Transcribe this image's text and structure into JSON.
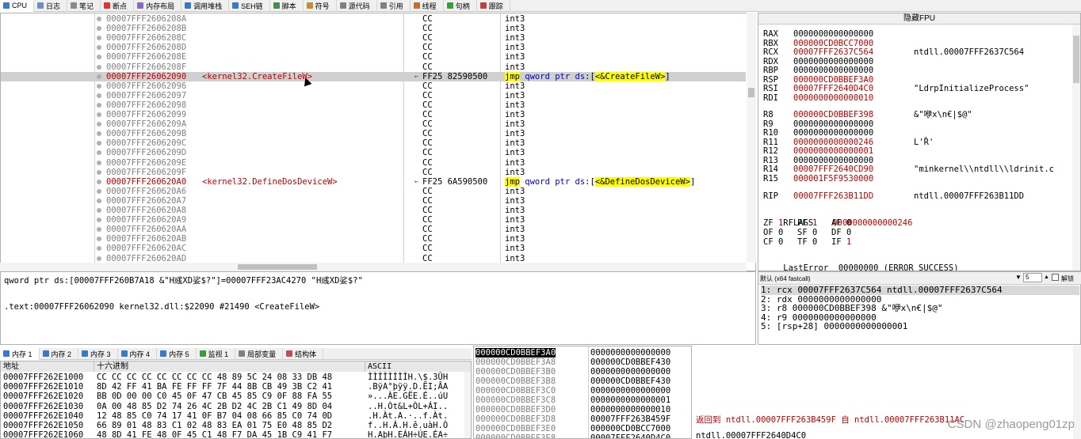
{
  "top_tabs": [
    {
      "label": "CPU",
      "color": "#3c78c8"
    },
    {
      "label": "日志",
      "color": "#6a8fc0"
    },
    {
      "label": "笔记",
      "color": "#8a8a8a"
    },
    {
      "label": "断点",
      "color": "#e03030"
    },
    {
      "label": "内存布局",
      "color": "#8a6ac0"
    },
    {
      "label": "调用堆栈",
      "color": "#3c78c8"
    },
    {
      "label": "SEH链",
      "color": "#3c78c8"
    },
    {
      "label": "脚本",
      "color": "#4a8a4a"
    },
    {
      "label": "符号",
      "color": "#c09030"
    },
    {
      "label": "源代码",
      "color": "#808080"
    },
    {
      "label": "引用",
      "color": "#808080"
    },
    {
      "label": "线程",
      "color": "#c07030"
    },
    {
      "label": "句柄",
      "color": "#3c9c3c"
    },
    {
      "label": "跟踪",
      "color": "#c04040"
    }
  ],
  "disasm_rows": [
    {
      "addr": "00007FFF2606208A",
      "bytes": "CC",
      "ins": "int3"
    },
    {
      "addr": "00007FFF2606208B",
      "bytes": "CC",
      "ins": "int3"
    },
    {
      "addr": "00007FFF2606208C",
      "bytes": "CC",
      "ins": "int3"
    },
    {
      "addr": "00007FFF2606208D",
      "bytes": "CC",
      "ins": "int3"
    },
    {
      "addr": "00007FFF2606208E",
      "bytes": "CC",
      "ins": "int3"
    },
    {
      "addr": "00007FFF2606208F",
      "bytes": "CC",
      "ins": "int3"
    },
    {
      "addr": "00007FFF26062090",
      "label": "<kernel32.CreateFileW>",
      "bytes": "FF25 82590500",
      "ins_jmp": "jmp",
      "ins_mid": " qword ptr ",
      "ins_ds": "ds",
      "ins_open": ":[",
      "ins_target": "<&CreateFileW>",
      "ins_close": "]",
      "selected": true
    },
    {
      "addr": "00007FFF26062096",
      "bytes": "CC",
      "ins": "int3"
    },
    {
      "addr": "00007FFF26062097",
      "bytes": "CC",
      "ins": "int3"
    },
    {
      "addr": "00007FFF26062098",
      "bytes": "CC",
      "ins": "int3"
    },
    {
      "addr": "00007FFF26062099",
      "bytes": "CC",
      "ins": "int3"
    },
    {
      "addr": "00007FFF2606209A",
      "bytes": "CC",
      "ins": "int3"
    },
    {
      "addr": "00007FFF2606209B",
      "bytes": "CC",
      "ins": "int3"
    },
    {
      "addr": "00007FFF2606209C",
      "bytes": "CC",
      "ins": "int3"
    },
    {
      "addr": "00007FFF2606209D",
      "bytes": "CC",
      "ins": "int3"
    },
    {
      "addr": "00007FFF2606209E",
      "bytes": "CC",
      "ins": "int3"
    },
    {
      "addr": "00007FFF2606209F",
      "bytes": "CC",
      "ins": "int3"
    },
    {
      "addr": "00007FFF260620A0",
      "label": "<kernel32.DefineDosDeviceW>",
      "bytes": "FF25 6A590500",
      "ins_jmp": "jmp",
      "ins_mid": " qword ptr ",
      "ins_ds": "ds",
      "ins_open": ":[",
      "ins_target": "<&DefineDosDeviceW>",
      "ins_close": "]"
    },
    {
      "addr": "00007FFF260620A6",
      "bytes": "CC",
      "ins": "int3"
    },
    {
      "addr": "00007FFF260620A7",
      "bytes": "CC",
      "ins": "int3"
    },
    {
      "addr": "00007FFF260620A8",
      "bytes": "CC",
      "ins": "int3"
    },
    {
      "addr": "00007FFF260620A9",
      "bytes": "CC",
      "ins": "int3"
    },
    {
      "addr": "00007FFF260620AA",
      "bytes": "CC",
      "ins": "int3"
    },
    {
      "addr": "00007FFF260620AB",
      "bytes": "CC",
      "ins": "int3"
    },
    {
      "addr": "00007FFF260620AC",
      "bytes": "CC",
      "ins": "int3"
    },
    {
      "addr": "00007FFF260620AD",
      "bytes": "CC",
      "ins": "int3"
    }
  ],
  "regs": {
    "title": "隐藏FPU",
    "rows": [
      {
        "n": "RAX",
        "v": "0000000000000000",
        "c": ""
      },
      {
        "n": "RBX",
        "v": "000000CD0BCC7000",
        "c": "",
        "red": true
      },
      {
        "n": "RCX",
        "v": "00007FFF2637C564",
        "c": "ntdll.00007FFF2637C564",
        "red": true
      },
      {
        "n": "RDX",
        "v": "0000000000000000",
        "c": ""
      },
      {
        "n": "RBP",
        "v": "0000000000000000",
        "c": ""
      },
      {
        "n": "RSP",
        "v": "000000CD0BBEF3A0",
        "c": "",
        "red": true
      },
      {
        "n": "RSI",
        "v": "00007FFF2640D4C0",
        "c": "\"LdrpInitializeProcess\"",
        "red": true
      },
      {
        "n": "RDI",
        "v": "0000000000000010",
        "c": "",
        "red": true
      },
      {
        "n": "R8",
        "v": "000000CD0BBEF398",
        "c": "&\"咿x\\n€|$@\"",
        "red": true
      },
      {
        "n": "R9",
        "v": "0000000000000000",
        "c": ""
      },
      {
        "n": "R10",
        "v": "0000000000000000",
        "c": ""
      },
      {
        "n": "R11",
        "v": "0000000000000246",
        "c": "L'Ȑ'",
        "red": true
      },
      {
        "n": "R12",
        "v": "0000000000000001",
        "c": "",
        "red": true
      },
      {
        "n": "R13",
        "v": "0000000000000000",
        "c": ""
      },
      {
        "n": "R14",
        "v": "00007FFF2640CD90",
        "c": "\"minkernel\\\\ntdll\\\\ldrinit.c",
        "red": true
      },
      {
        "n": "R15",
        "v": "000001F5F9530000",
        "c": "",
        "red": true
      },
      {
        "n": "RIP",
        "v": "00007FFF263B11DD",
        "c": "ntdll.00007FFF263B11DD",
        "red": true
      }
    ],
    "rflags_label": "RFLAGS",
    "rflags_value": "0000000000000246",
    "flags_line1": [
      [
        "ZF",
        "1",
        true
      ],
      [
        "PF",
        "1",
        true
      ],
      [
        "AF",
        "0",
        false
      ]
    ],
    "flags_line2": [
      [
        "OF",
        "0",
        false
      ],
      [
        "SF",
        "0",
        false
      ],
      [
        "DF",
        "0",
        false
      ]
    ],
    "flags_line3": [
      [
        "CF",
        "0",
        false
      ],
      [
        "TF",
        "0",
        false
      ],
      [
        "IF",
        "1",
        true
      ]
    ],
    "lasterror_label": "LastError",
    "lasterror_value": "00000000 (ERROR_SUCCESS)"
  },
  "info": {
    "line1": "qword ptr ds:[00007FFF260B7A18 &\"H彧XD娑$?\"]=00007FFF23AC4270 \"H彧XD娑$?\"",
    "line2": ".text:00007FFF26062090 kernel32.dll:$22090 #21490 <CreateFileW>"
  },
  "callstack": {
    "convention": "默认 (x64 fastcall)",
    "count": "5",
    "unlock": "解锁",
    "rows": [
      "1: rcx 00007FFF2637C564 ntdll.00007FFF2637C564",
      "2: rdx 0000000000000000",
      "3: r8 000000CD0BBEF398 &\"咿x\\n€|$@\"",
      "4: r9 0000000000000000",
      "5: [rsp+28] 0000000000000001"
    ]
  },
  "bottom_tabs": [
    {
      "label": "内存 1",
      "color": "#3c78c8"
    },
    {
      "label": "内存 2",
      "color": "#3c78c8"
    },
    {
      "label": "内存 3",
      "color": "#3c78c8"
    },
    {
      "label": "内存 4",
      "color": "#3c78c8"
    },
    {
      "label": "内存 5",
      "color": "#3c78c8"
    },
    {
      "label": "监视 1",
      "color": "#3c9c3c"
    },
    {
      "label": "局部变量",
      "color": "#808080"
    },
    {
      "label": "结构体",
      "color": "#c05050"
    }
  ],
  "dump": {
    "h_addr": "地址",
    "h_hex": "十六进制",
    "h_ascii": "ASCII",
    "rows": [
      {
        "a": "00007FFF262E1000",
        "h": "CC CC CC CC CC CC CC CC 48 89 5C 24 08 33 DB 48",
        "s": "ÌÌÌÌÌÌÌÌH.\\$.3ÛH"
      },
      {
        "a": "00007FFF262E1010",
        "h": "8D 42 FF 41 BA FE FF FF 7F 44 8B CB 49 3B C2 41",
        "s": ".BÿA°þÿÿ.D.ËI;ÂA"
      },
      {
        "a": "00007FFF262E1020",
        "h": "BB 0D 00 00 C0 45 0F 47 CB 45 85 C9 0F 88 FA 55",
        "s": "»...ÀE.GËE.É..úU"
      },
      {
        "a": "00007FFF262E1030",
        "h": "0A 00 48 85 D2 74 26 4C 2B D2 4C 2B C1 49 8D 04",
        "s": "..H.Òt&L+ÒL+ÁI.."
      },
      {
        "a": "00007FFF262E1040",
        "h": "12 48 85 C0 74 17 41 0F B7 04 08 66 85 C0 74 0D",
        "s": ".H.Àt.A.·..f.Àt."
      },
      {
        "a": "00007FFF262E1050",
        "h": "66 89 01 48 83 C1 02 48 83 EA 01 75 E0 48 85 D2",
        "s": "f..H.Á.H.ê.uàH.Ò"
      },
      {
        "a": "00007FFF262E1060",
        "h": "48 8D 41 FE 48 0F 45 C1 48 F7 DA 45 1B C9 41 F7",
        "s": "H.AþH.EÁH÷ÚE.ÉA÷"
      }
    ]
  },
  "stack": {
    "rows": [
      {
        "a": "000000CD0BBEF3A0",
        "v": "0000000000000000",
        "sel": true
      },
      {
        "a": "000000CD0BBEF3A8",
        "v": "000000CD0BBEF430"
      },
      {
        "a": "000000CD0BBEF3B0",
        "v": "0000000000000000"
      },
      {
        "a": "000000CD0BBEF3B8",
        "v": "000000CD0BBEF430"
      },
      {
        "a": "000000CD0BBEF3C0",
        "v": "0000000000000000"
      },
      {
        "a": "000000CD0BBEF3C8",
        "v": "0000000000000001"
      },
      {
        "a": "000000CD0BBEF3D0",
        "v": "0000000000000010"
      },
      {
        "a": "000000CD0BBEF3D8",
        "v": "00007FFF263B459F",
        "red": true
      },
      {
        "a": "000000CD0BBEF3E0",
        "v": "000000CD0BCC7000"
      },
      {
        "a": "000000CD0BBEF3E8",
        "v": "00007FFF2640D4C0"
      }
    ],
    "comment1": "返回到 ntdll.00007FFF263B459F 自 ntdll.00007FFF263B11AC",
    "comment2": "ntdll.00007FFF2640D4C0"
  },
  "watermark": "CSDN @zhaopeng01zp"
}
